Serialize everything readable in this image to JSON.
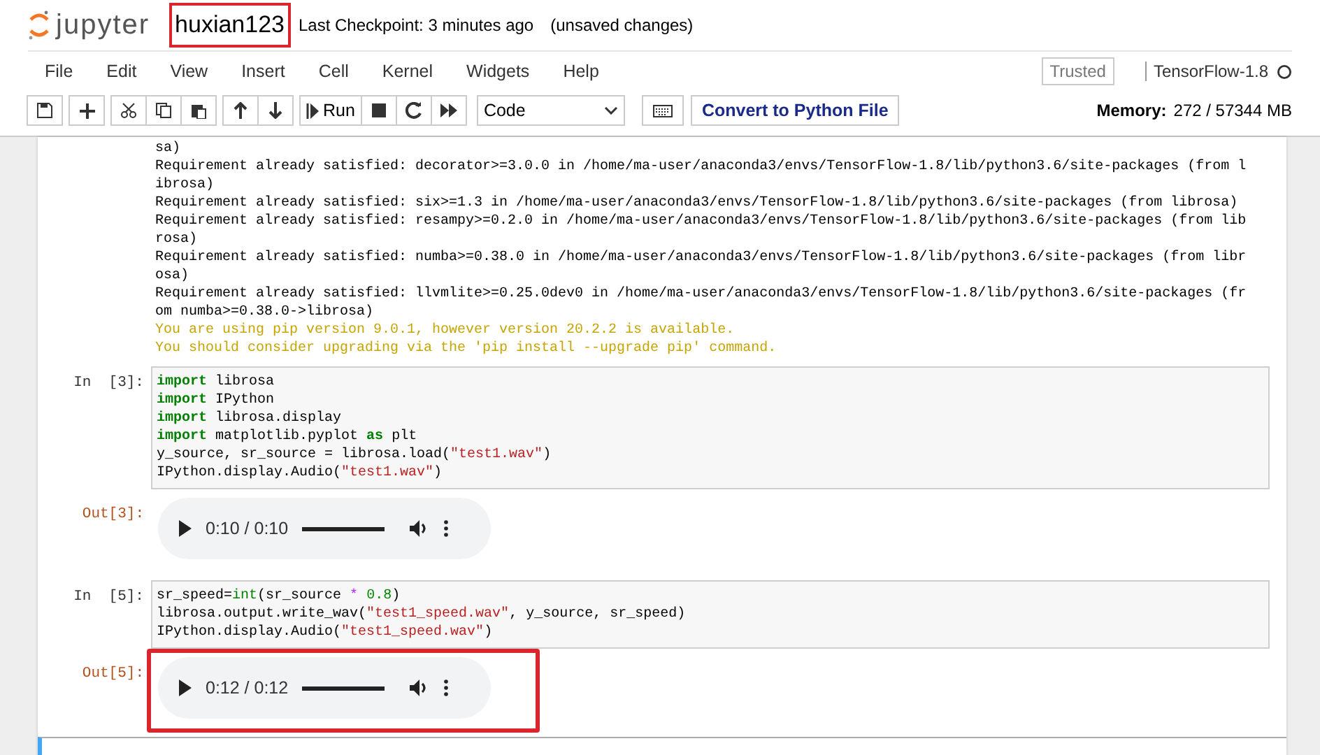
{
  "header": {
    "logo_text": "jupyter",
    "notebook_name": "huxian123",
    "name_highlighted": true,
    "checkpoint": "Last Checkpoint: 3 minutes ago",
    "autosave_status": "(unsaved changes)"
  },
  "menu": {
    "items": [
      "File",
      "Edit",
      "View",
      "Insert",
      "Cell",
      "Kernel",
      "Widgets",
      "Help"
    ],
    "trusted_badge": "Trusted",
    "kernel_name": "TensorFlow-1.8",
    "kernel_busy": false
  },
  "toolbar": {
    "run_label": "Run",
    "cell_type": "Code",
    "convert_button": "Convert to Python File",
    "memory_label": "Memory:",
    "memory_value": "272 / 57344 MB"
  },
  "cells": [
    {
      "selected": false,
      "output": {
        "kind": "stream",
        "lines": [
          {
            "kind": "stderr",
            "text": "sa)"
          },
          {
            "kind": "stderr",
            "text": "Requirement already satisfied: decorator>=3.0.0 in /home/ma-user/anaconda3/envs/TensorFlow-1.8/lib/python3.6/site-packages (from l"
          },
          {
            "kind": "stderr",
            "text": "ibrosa)"
          },
          {
            "kind": "stderr",
            "text": "Requirement already satisfied: six>=1.3 in /home/ma-user/anaconda3/envs/TensorFlow-1.8/lib/python3.6/site-packages (from librosa)"
          },
          {
            "kind": "stderr",
            "text": "Requirement already satisfied: resampy>=0.2.0 in /home/ma-user/anaconda3/envs/TensorFlow-1.8/lib/python3.6/site-packages (from lib"
          },
          {
            "kind": "stderr",
            "text": "rosa)"
          },
          {
            "kind": "stderr",
            "text": "Requirement already satisfied: numba>=0.38.0 in /home/ma-user/anaconda3/envs/TensorFlow-1.8/lib/python3.6/site-packages (from libr"
          },
          {
            "kind": "stderr",
            "text": "osa)"
          },
          {
            "kind": "stderr",
            "text": "Requirement already satisfied: llvmlite>=0.25.0dev0 in /home/ma-user/anaconda3/envs/TensorFlow-1.8/lib/python3.6/site-packages (fr"
          },
          {
            "kind": "stderr",
            "text": "om numba>=0.38.0->librosa)"
          },
          {
            "kind": "warning",
            "text": "You are using pip version 9.0.1, however version 20.2.2 is available."
          },
          {
            "kind": "warning",
            "text": "You should consider upgrading via the 'pip install --upgrade pip' command."
          }
        ]
      }
    },
    {
      "selected": false,
      "in_prompt": "In  [3]:",
      "code": [
        [
          {
            "kind": "keyword",
            "text": "import"
          },
          {
            "kind": "plain",
            "text": " librosa"
          }
        ],
        [
          {
            "kind": "keyword",
            "text": "import"
          },
          {
            "kind": "plain",
            "text": " IPython"
          }
        ],
        [
          {
            "kind": "keyword",
            "text": "import"
          },
          {
            "kind": "plain",
            "text": " librosa.display"
          }
        ],
        [
          {
            "kind": "keyword",
            "text": "import"
          },
          {
            "kind": "plain",
            "text": " matplotlib.pyplot "
          },
          {
            "kind": "keyword",
            "text": "as"
          },
          {
            "kind": "plain",
            "text": " plt"
          }
        ],
        [
          {
            "kind": "plain",
            "text": "y_source, sr_source = librosa.load("
          },
          {
            "kind": "string",
            "text": "\"test1.wav\""
          },
          {
            "kind": "plain",
            "text": ")"
          }
        ],
        [
          {
            "kind": "plain",
            "text": "IPython.display.Audio("
          },
          {
            "kind": "string",
            "text": "\"test1.wav\""
          },
          {
            "kind": "plain",
            "text": ")"
          }
        ]
      ],
      "out_prompt": "Out[3]:",
      "output": {
        "kind": "audio",
        "time": "0:10 / 0:10",
        "level": 1,
        "highlighted": false
      }
    },
    {
      "selected": false,
      "in_prompt": "In  [5]:",
      "code": [
        [
          {
            "kind": "plain",
            "text": "sr_speed="
          },
          {
            "kind": "builtin",
            "text": "int"
          },
          {
            "kind": "plain",
            "text": "(sr_source "
          },
          {
            "kind": "operator",
            "text": "* "
          },
          {
            "kind": "number",
            "text": "0.8"
          },
          {
            "kind": "plain",
            "text": ")"
          }
        ],
        [
          {
            "kind": "plain",
            "text": "librosa.output.write_wav("
          },
          {
            "kind": "string",
            "text": "\"test1_speed.wav\""
          },
          {
            "kind": "plain",
            "text": ", y_source, sr_speed)"
          }
        ],
        [
          {
            "kind": "plain",
            "text": "IPython.display.Audio("
          },
          {
            "kind": "string",
            "text": "\"test1_speed.wav\""
          },
          {
            "kind": "plain",
            "text": ")"
          }
        ]
      ],
      "out_prompt": "Out[5]:",
      "output": {
        "kind": "audio",
        "time": "0:12 / 0:12",
        "level": 1,
        "highlighted": true
      }
    },
    {
      "selected": true
    }
  ]
}
